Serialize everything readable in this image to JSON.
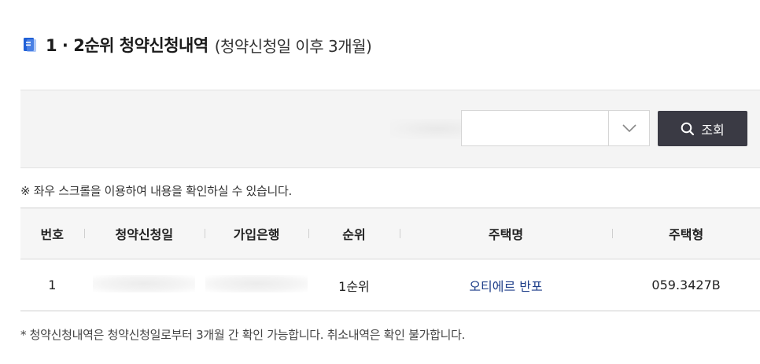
{
  "section": {
    "title": "1 · 2순위 청약신청내역",
    "subtitle": "(청약신청일 이후 3개월)"
  },
  "search": {
    "select_value": "",
    "button_label": "조회"
  },
  "scroll_note": "※ 좌우 스크롤을 이용하여 내용을 확인하실 수 있습니다.",
  "table": {
    "headers": [
      "번호",
      "청약신청일",
      "가입은행",
      "순위",
      "주택명",
      "주택형"
    ],
    "rows": [
      {
        "no": "1",
        "date": "",
        "bank": "",
        "rank": "1순위",
        "house": "오티에르 반포",
        "type": "059.3427B"
      }
    ]
  },
  "footnote": "* 청약신청내역은 청약신청일로부터 3개월 간 확인 가능합니다. 취소내역은 확인 불가합니다.",
  "colors": {
    "accent": "#1f5fd6",
    "button": "#3a3a44",
    "link": "#1f3f8a"
  },
  "icons": {
    "title": "document-icon",
    "search": "search-icon",
    "select": "chevron-down-icon"
  }
}
